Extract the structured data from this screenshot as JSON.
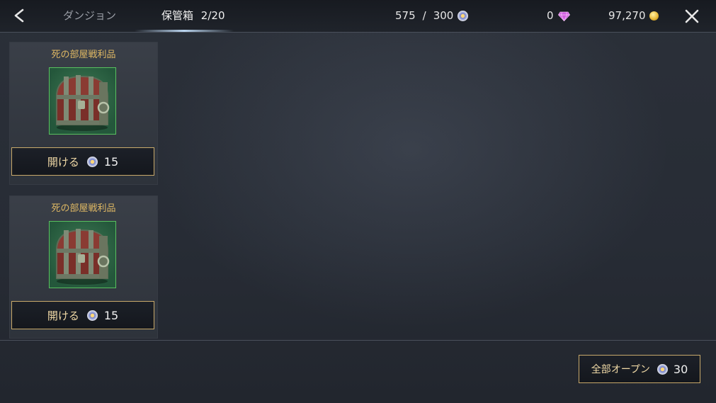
{
  "header": {
    "tabs": [
      {
        "label": "ダンジョン",
        "active": false
      },
      {
        "label": "保管箱",
        "active": true
      }
    ],
    "storage_count": "2/20",
    "points": {
      "current": "575",
      "separator": "/",
      "max": "300",
      "icon": "orb-coin-icon"
    },
    "gems": {
      "value": "0",
      "icon": "diamond-icon"
    },
    "gold": {
      "value": "97,270",
      "icon": "gold-coin-icon"
    }
  },
  "chests": [
    {
      "name": "死の部屋戦利品",
      "open_label": "開ける",
      "cost": "15",
      "icon": "treasure-chest-icon"
    },
    {
      "name": "死の部屋戦利品",
      "open_label": "開ける",
      "cost": "15",
      "icon": "treasure-chest-icon"
    }
  ],
  "footer": {
    "open_all_label": "全部オープン",
    "open_all_cost": "30"
  },
  "colors": {
    "accent_gold": "#c8a96a",
    "title_gold": "#e0b964",
    "frame_green": "#58c05f",
    "gem_pink": "#e070e8"
  }
}
